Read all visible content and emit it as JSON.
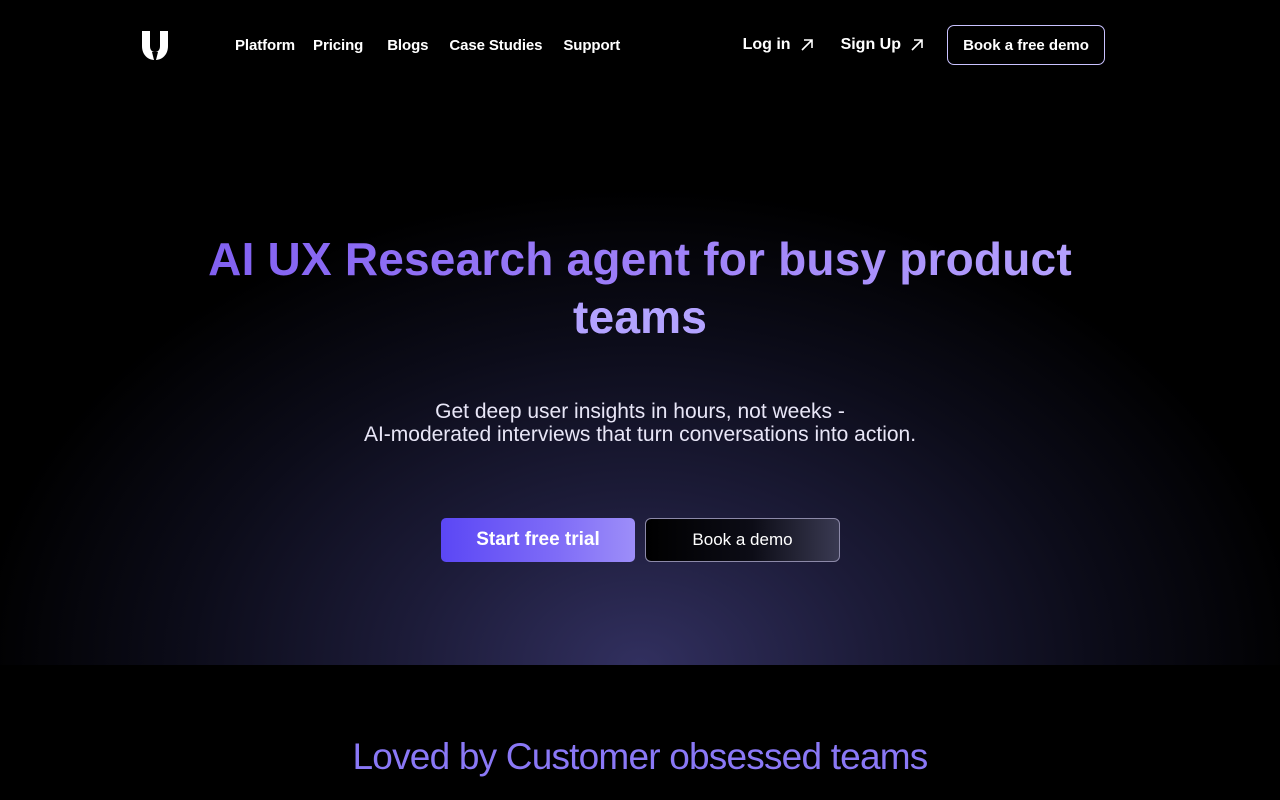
{
  "nav": {
    "logo_icon": "u-magnet-logo-icon",
    "links": [
      {
        "label": "Platform"
      },
      {
        "label": "Pricing"
      },
      {
        "label": "Blogs"
      },
      {
        "label": "Case Studies"
      },
      {
        "label": "Support"
      }
    ],
    "login_label": "Log in",
    "signup_label": "Sign Up",
    "external_icon": "arrow-up-right-icon",
    "demo_label": "Book a free demo"
  },
  "hero": {
    "headline_line1": "AI UX Research agent for busy product",
    "headline_line2": "teams",
    "subtitle_line1": "Get deep user insights in hours, not weeks -",
    "subtitle_line2": "AI-moderated interviews that turn conversations into action.",
    "primary_cta": "Start free trial",
    "secondary_cta": "Book a demo"
  },
  "section": {
    "heading": "Loved by Customer obsessed teams"
  },
  "colors": {
    "accent": "#7d5cf0",
    "accent_light": "#b3a3ff",
    "button_primary": "#5b47f5",
    "background": "#000000"
  }
}
